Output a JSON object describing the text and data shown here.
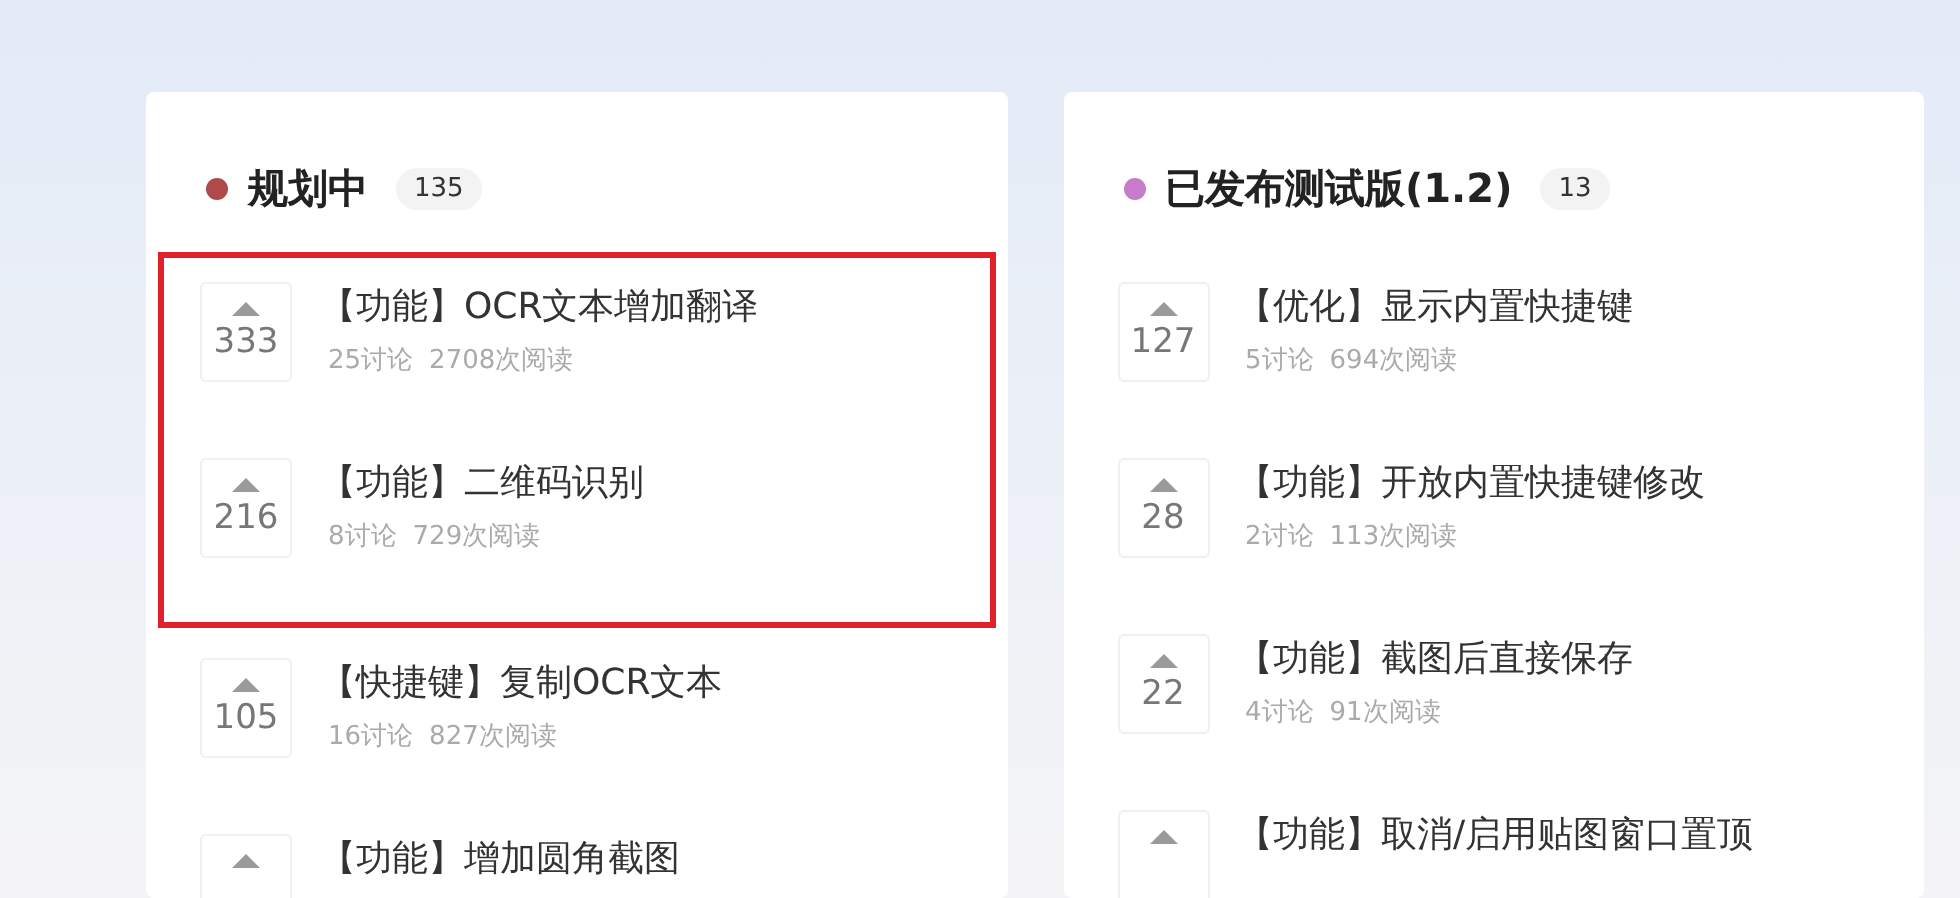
{
  "columns": [
    {
      "title": "规划中",
      "color": "#b04a4a",
      "count": "135",
      "groups": [
        {
          "highlighted": true,
          "items": [
            {
              "votes": "333",
              "title": "【功能】OCR文本增加翻译",
              "discussions": "25讨论",
              "reads": "2708次阅读"
            },
            {
              "votes": "216",
              "title": "【功能】二维码识别",
              "discussions": "8讨论",
              "reads": "729次阅读"
            }
          ]
        },
        {
          "highlighted": false,
          "items": [
            {
              "votes": "105",
              "title": "【快捷键】复制OCR文本",
              "discussions": "16讨论",
              "reads": "827次阅读"
            },
            {
              "title": "【功能】增加圆角截图"
            }
          ]
        }
      ]
    },
    {
      "title": "已发布测试版(1.2)",
      "color": "#c77cc9",
      "count": "13",
      "groups": [
        {
          "highlighted": false,
          "items": [
            {
              "votes": "127",
              "title": "【优化】显示内置快捷键",
              "discussions": "5讨论",
              "reads": "694次阅读"
            },
            {
              "votes": "28",
              "title": "【功能】开放内置快捷键修改",
              "discussions": "2讨论",
              "reads": "113次阅读"
            },
            {
              "votes": "22",
              "title": "【功能】截图后直接保存",
              "discussions": "4讨论",
              "reads": "91次阅读"
            },
            {
              "title": "【功能】取消/启用贴图窗口置顶"
            }
          ]
        }
      ]
    }
  ]
}
